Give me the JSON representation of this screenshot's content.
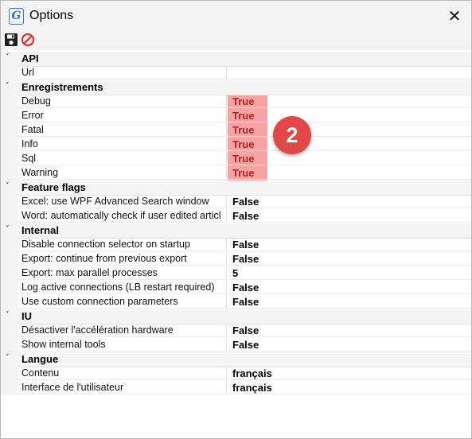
{
  "window": {
    "title": "Options",
    "close_glyph": "✕",
    "app_icon_letter": "G"
  },
  "toolbar": {
    "icons": [
      "save-icon",
      "cancel-icon"
    ]
  },
  "categories": [
    {
      "label": "API",
      "rows": [
        {
          "name": "Url",
          "value": ""
        }
      ]
    },
    {
      "label": "Enregistrements",
      "rows": [
        {
          "name": "Debug",
          "value": "True"
        },
        {
          "name": "Error",
          "value": "True"
        },
        {
          "name": "Fatal",
          "value": "True"
        },
        {
          "name": "Info",
          "value": "True"
        },
        {
          "name": "Sql",
          "value": "True"
        },
        {
          "name": "Warning",
          "value": "True"
        }
      ]
    },
    {
      "label": "Feature flags",
      "rows": [
        {
          "name": "Excel: use WPF Advanced Search window",
          "value": "False"
        },
        {
          "name": "Word: automatically check if user edited articl",
          "value": "False"
        }
      ]
    },
    {
      "label": "Internal",
      "rows": [
        {
          "name": "Disable connection selector on startup",
          "value": "False"
        },
        {
          "name": "Export: continue from previous export",
          "value": "False"
        },
        {
          "name": "Export: max parallel processes",
          "value": "5"
        },
        {
          "name": "Log active connections (LB restart required)",
          "value": "False"
        },
        {
          "name": "Use custom connection parameters",
          "value": "False"
        }
      ]
    },
    {
      "label": "IU",
      "rows": [
        {
          "name": "Désactiver l'accélération hardware",
          "value": "False"
        },
        {
          "name": "Show internal tools",
          "value": "False"
        }
      ]
    },
    {
      "label": "Langue",
      "rows": [
        {
          "name": "Contenu",
          "value": "français"
        },
        {
          "name": "Interface de l'utilisateur",
          "value": "français"
        }
      ]
    }
  ],
  "badge": {
    "number": "2"
  },
  "colors": {
    "highlight": "#f5a3a3",
    "badge": "#e34848",
    "true_text": "#b22222"
  }
}
